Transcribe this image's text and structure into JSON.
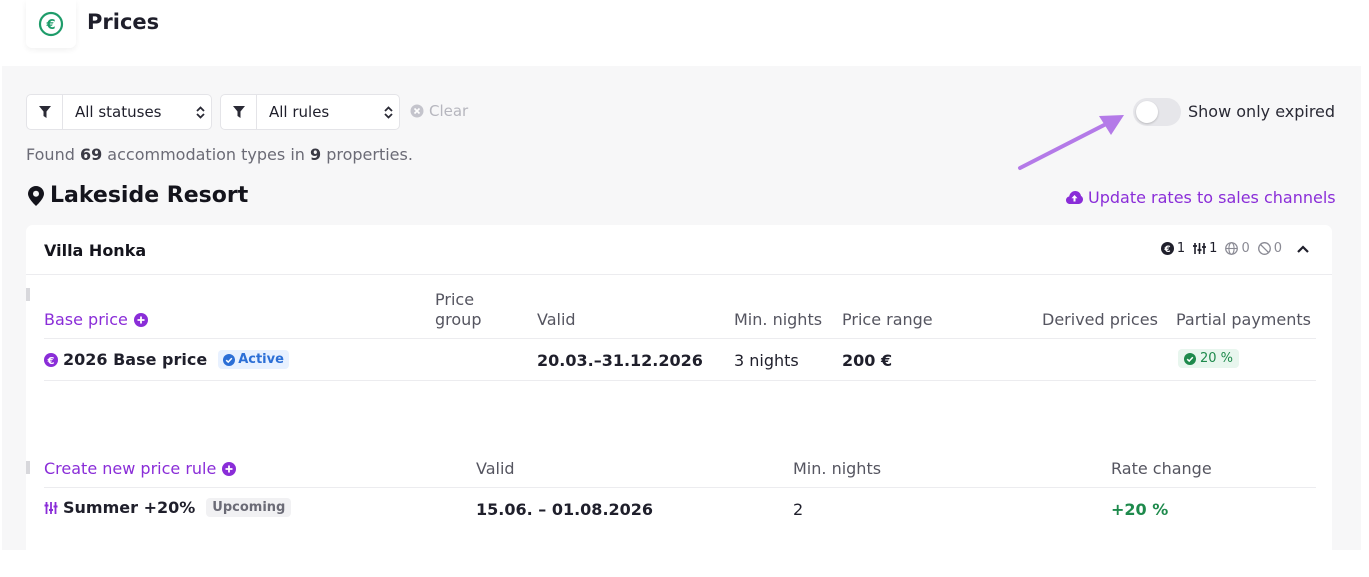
{
  "header": {
    "title": "Prices",
    "logo_icon": "euro-coin-icon"
  },
  "filters": {
    "status_select": "All statuses",
    "rules_select": "All rules",
    "clear_label": "Clear",
    "show_expired_label": "Show only expired",
    "show_expired_on": false
  },
  "summary": {
    "prefix": "Found ",
    "accommodation_count": "69",
    "middle": " accommodation types in ",
    "property_count": "9",
    "suffix": " properties."
  },
  "property": {
    "name": "Lakeside Resort",
    "update_link": "Update rates to sales channels"
  },
  "accommodation": {
    "name": "Villa Honka",
    "counts": [
      "1",
      "1",
      "0",
      "0"
    ]
  },
  "base_price_table": {
    "headers": {
      "base_price": "Base price",
      "price_group_1": "Price",
      "price_group_2": "group",
      "valid": "Valid",
      "min_nights": "Min. nights",
      "price_range": "Price range",
      "derived": "Derived prices",
      "partial": "Partial payments"
    },
    "row": {
      "name": "2026 Base price",
      "status": "Active",
      "valid": "20.03.–31.12.2026",
      "min_nights": "3 nights",
      "price_range": "200 €",
      "partial": "20 %"
    }
  },
  "rules_table": {
    "headers": {
      "create": "Create new price rule",
      "valid": "Valid",
      "min_nights": "Min. nights",
      "rate_change": "Rate change"
    },
    "row": {
      "name": "Summer +20%",
      "status": "Upcoming",
      "valid": "15.06. – 01.08.2026",
      "min_nights": "2",
      "rate_change": "+20 %"
    }
  },
  "colors": {
    "accent": "#8a2dd8",
    "green": "#1e8a4c",
    "arrow": "#b47ae8"
  }
}
